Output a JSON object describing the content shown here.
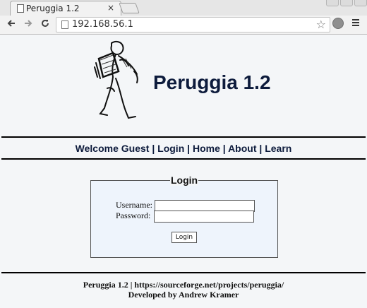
{
  "browser": {
    "tab_title": "Peruggia 1.2",
    "tab_close": "×",
    "url": "192.168.56.1",
    "icons": [
      "back-arrow-icon",
      "forward-arrow-icon",
      "reload-icon",
      "bookmark-star-icon",
      "globe-icon",
      "menu-icon"
    ]
  },
  "site": {
    "title": "Peruggia 1.2"
  },
  "nav": {
    "welcome": "Welcome Guest",
    "sep": "|",
    "links": [
      "Login",
      "Home",
      "About",
      "Learn"
    ]
  },
  "login": {
    "legend": "Login",
    "username_label": "Username:",
    "password_label": "Password:",
    "username_value": "",
    "password_value": "",
    "button_label": "Login"
  },
  "footer": {
    "line1": "Peruggia 1.2 | https://sourceforge.net/projects/peruggia/",
    "line2": "Developed by Andrew Kramer"
  }
}
